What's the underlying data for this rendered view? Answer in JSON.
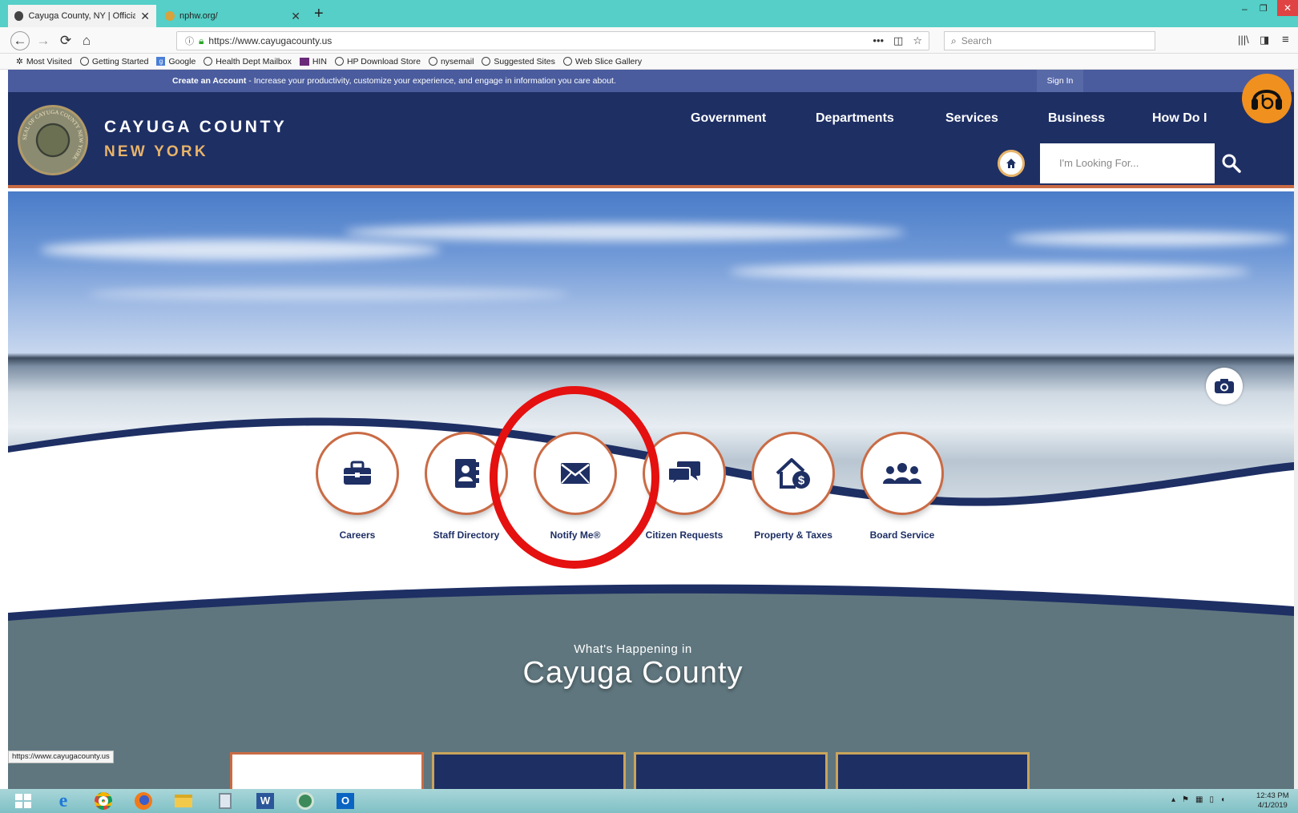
{
  "browser": {
    "tabs": [
      {
        "title": "Cayuga County, NY | Official W"
      },
      {
        "title": "nphw.org/"
      }
    ],
    "url": "https://www.cayugacounty.us",
    "search_placeholder": "Search",
    "bookmarks": [
      "Most Visited",
      "Getting Started",
      "Google",
      "Health Dept Mailbox",
      "HIN",
      "HP Download Store",
      "nysemail",
      "Suggested Sites",
      "Web Slice Gallery"
    ],
    "status_url": "https://www.cayugacounty.us"
  },
  "site": {
    "topbar": {
      "create_account": "Create an Account",
      "tagline": " - Increase your productivity, customize your experience, and engage in information you care about.",
      "sign_in": "Sign In"
    },
    "brand": {
      "name": "CAYUGA COUNTY",
      "state": "NEW YORK",
      "seal_text": "SEAL OF CAYUGA COUNTY NEW YORK"
    },
    "nav": [
      "Government",
      "Departments",
      "Services",
      "Business",
      "How Do I"
    ],
    "search_placeholder": "I'm Looking For...",
    "quick_links": [
      "Careers",
      "Staff Directory",
      "Notify Me®",
      "Citizen Requests",
      "Property & Taxes",
      "Board Service"
    ],
    "happening": {
      "subtitle": "What's Happening in",
      "title": "Cayuga County"
    }
  },
  "taskbar": {
    "time": "12:43 PM",
    "date": "4/1/2019"
  },
  "colors": {
    "navy": "#1e2f64",
    "accent_orange": "#c96b45",
    "highlight_circle": "#e51010"
  }
}
